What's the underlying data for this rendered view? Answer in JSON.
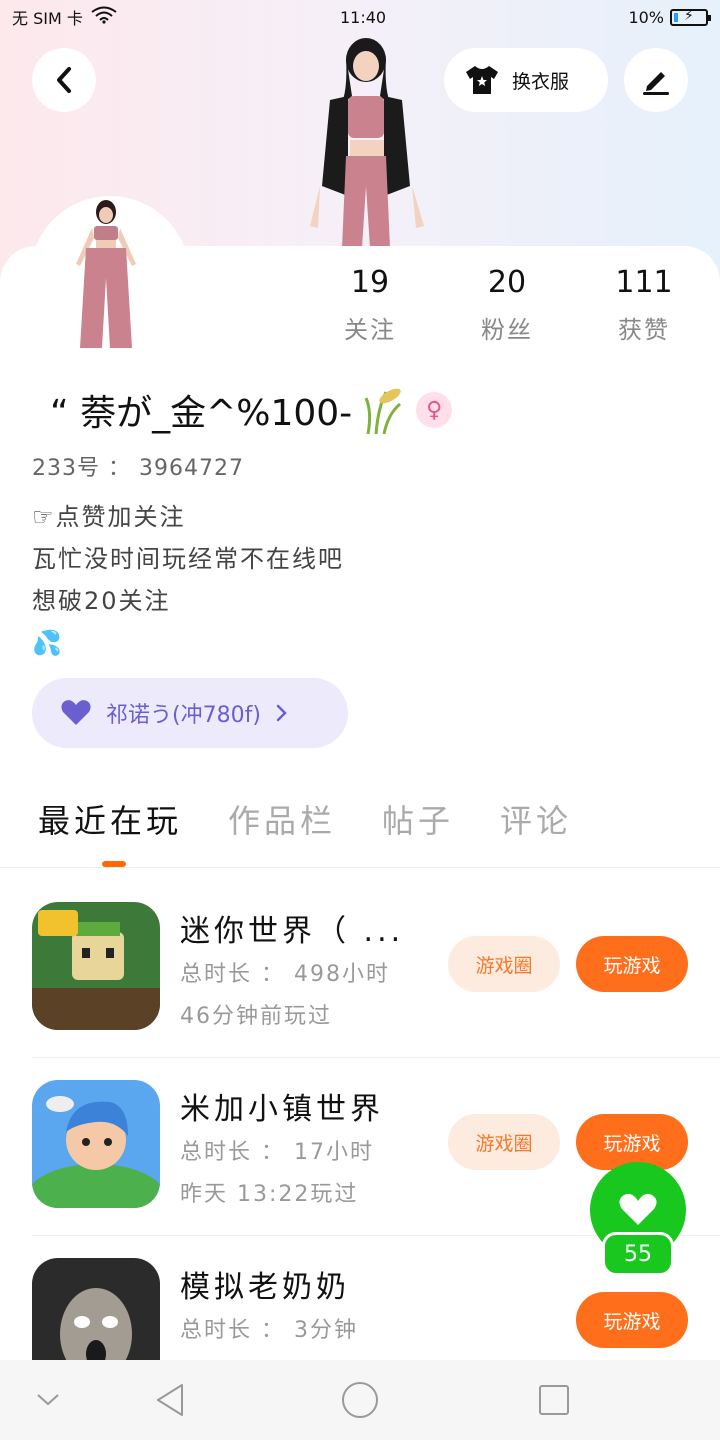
{
  "status_bar": {
    "carrier": "无 SIM 卡",
    "time": "11:40",
    "battery": "10%"
  },
  "header": {
    "outfit_label": "换衣服"
  },
  "profile": {
    "username": "“ 萘が_金^%100-",
    "gender_symbol": "♀",
    "id_label": "233号 ： 3964727",
    "bio_lines": [
      "☞点赞加关注",
      "瓦忙没时间玩经常不在线吧",
      "想破20关注",
      "💦"
    ],
    "tag_label": "祁诺う(冲780f)"
  },
  "stats": [
    {
      "value": "19",
      "label": "关注"
    },
    {
      "value": "20",
      "label": "粉丝"
    },
    {
      "value": "111",
      "label": "获赞"
    }
  ],
  "tabs": [
    "最近在玩",
    "作品栏",
    "帖子",
    "评论"
  ],
  "games": [
    {
      "title": "迷你世界（ ...",
      "duration": "总时长 ： 498小时",
      "last_played": "46分钟前玩过",
      "circle_label": "游戏圈",
      "play_label": "玩游戏"
    },
    {
      "title": "米加小镇世界",
      "duration": "总时长 ： 17小时",
      "last_played": "昨天 13:22玩过",
      "circle_label": "游戏圈",
      "play_label": "玩游戏"
    },
    {
      "title": "模拟老奶奶",
      "duration": "总时长 ： 3分钟",
      "last_played": "",
      "circle_label": "",
      "play_label": "玩游戏"
    }
  ],
  "floating_like": {
    "count": "55"
  },
  "colors": {
    "accent_orange": "#ff6e1a",
    "like_green": "#19c81e",
    "tag_purple": "#6a5fd0"
  }
}
